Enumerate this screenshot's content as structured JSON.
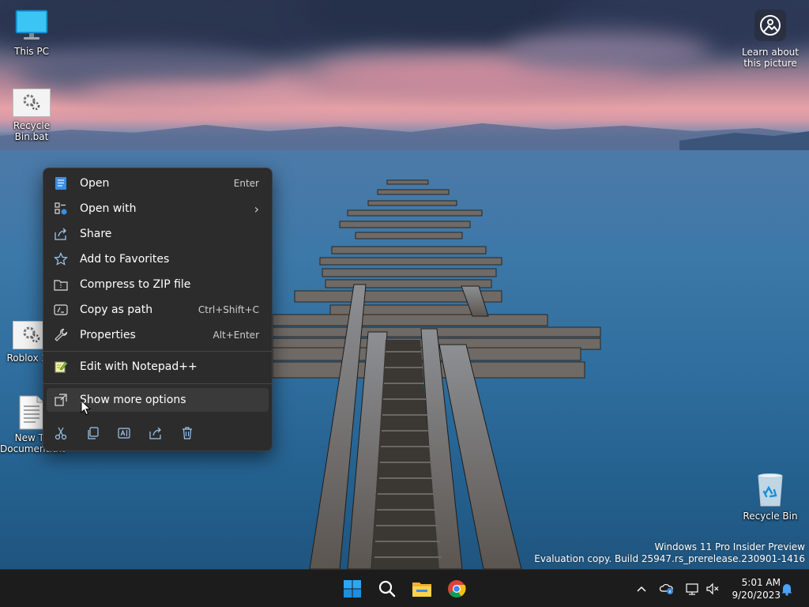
{
  "desktop": {
    "icons": [
      {
        "label": "This PC"
      },
      {
        "label": "Recycle\nBin.bat"
      },
      {
        "label": "Roblox 2.0"
      },
      {
        "label": "New Te\nDocument.txt"
      },
      {
        "label": "Recycle Bin"
      }
    ],
    "learn_about": "Learn about\nthis picture",
    "watermark": {
      "line1": "Windows 11 Pro Insider Preview",
      "line2": "Evaluation copy. Build 25947.rs_prerelease.230901-1416"
    }
  },
  "context_menu": {
    "items": [
      {
        "label": "Open",
        "shortcut": "Enter",
        "icon": "notepad-doc-icon"
      },
      {
        "label": "Open with",
        "shortcut": "",
        "icon": "open-with-icon"
      },
      {
        "label": "Share",
        "shortcut": "",
        "icon": "share-icon"
      },
      {
        "label": "Add to Favorites",
        "shortcut": "",
        "icon": "star-icon"
      },
      {
        "label": "Compress to ZIP file",
        "shortcut": "",
        "icon": "zip-folder-icon"
      },
      {
        "label": "Copy as path",
        "shortcut": "Ctrl+Shift+C",
        "icon": "copy-path-icon"
      },
      {
        "label": "Properties",
        "shortcut": "Alt+Enter",
        "icon": "wrench-icon"
      },
      {
        "label": "Edit with Notepad++",
        "shortcut": "",
        "icon": "notepadpp-icon"
      },
      {
        "label": "Show more options",
        "shortcut": "",
        "icon": "show-more-icon"
      }
    ],
    "quick_actions": [
      "cut-icon",
      "copy-icon",
      "rename-icon",
      "share-icon",
      "delete-icon"
    ]
  },
  "taskbar": {
    "apps": [
      "start-icon",
      "search-icon",
      "file-explorer-icon",
      "chrome-icon"
    ],
    "clock": {
      "time": "5:01 AM",
      "date": "9/20/2023"
    }
  },
  "colors": {
    "menu_bg": "#2c2c2c",
    "taskbar_bg": "#1c1c1c",
    "accent": "#0078d4"
  }
}
